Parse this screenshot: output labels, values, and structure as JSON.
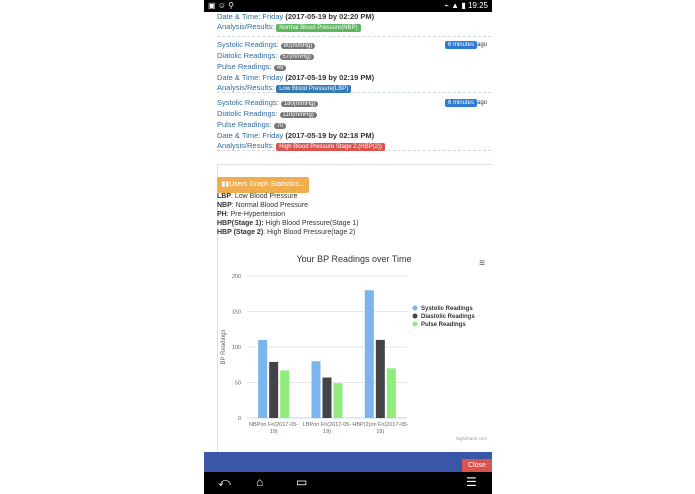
{
  "status": {
    "time": "19:25",
    "left_icons": "▣ ☺ ⚲",
    "right_icons": "⌁ ▲ ▮"
  },
  "records": [
    {
      "datetime_prefix": "Date & Time: Friday",
      "datetime": "(2017-05-19 by 02:20 PM)",
      "analysis_label": "Analysis/Results:",
      "analysis": "Normal Blood Pressure(NBP)",
      "analysis_color": "#5cb85c"
    },
    {
      "minutes": "6 minutes",
      "ago": "ago",
      "systolic_label": "Systolic Readings:",
      "systolic": "80(mmHg)",
      "diastolic_label": "Diatolic Readings:",
      "diastolic": "57(mmHg)",
      "pulse_label": "Pulse Readings:",
      "pulse": "49",
      "datetime_prefix": "Date & Time: Friday",
      "datetime": "(2017-05-19 by 02:19 PM)",
      "analysis_label": "Analysis/Results:",
      "analysis": "Low Blood Pressure(LBP)",
      "analysis_color": "#337ab7"
    },
    {
      "minutes": "6 minutes",
      "ago": "ago",
      "systolic_label": "Systolic Readings:",
      "systolic": "180(mmHg)",
      "diastolic_label": "Diatolic Readings:",
      "diastolic": "110(mmHg)",
      "pulse_label": "Pulse Readings:",
      "pulse": "70",
      "datetime_prefix": "Date & Time: Friday",
      "datetime": "(2017-05-19 by 02:18 PM)",
      "analysis_label": "Analysis/Results:",
      "analysis": "High Blood Pressure Stage 2.(HBP(2))",
      "analysis_color": "#d9534f"
    }
  ],
  "graph_button": "Users Graph Statistics...",
  "abbreviations": [
    {
      "key": "LBP",
      "value": ": Low Blood Pressure"
    },
    {
      "key": "NBP",
      "value": ": Normal Blood Pressure"
    },
    {
      "key": "PH",
      "value": ": Pre-Hypertension"
    },
    {
      "key": "HBP(Stage 1):",
      "value": " High Blood Pressure(Stage 1)"
    },
    {
      "key": "HBP (Stage 2)",
      "value": ": High Blood Pressure(tage 2)"
    }
  ],
  "chart_data": {
    "type": "bar",
    "title": "Your BP Readings over Time",
    "ylabel": "BP Readings",
    "categories": [
      "NBPon Fri(2017-05-19)",
      "LBPon Fri(2017-05-19)",
      "HBP(2)on Fri(2017-05-19)"
    ],
    "ylim": [
      0,
      200
    ],
    "yticks": [
      0,
      50,
      100,
      150,
      200
    ],
    "series": [
      {
        "name": "Systolic Readings",
        "values": [
          110,
          80,
          180
        ],
        "color": "#7cb5ec"
      },
      {
        "name": "Diastolic Readings",
        "values": [
          79,
          57,
          110
        ],
        "color": "#434348"
      },
      {
        "name": "Pulse Readings",
        "values": [
          67,
          49,
          70
        ],
        "color": "#90ed7d"
      }
    ],
    "credit": "Highcharts.com",
    "legend_position": "right"
  },
  "close_label": "Close"
}
